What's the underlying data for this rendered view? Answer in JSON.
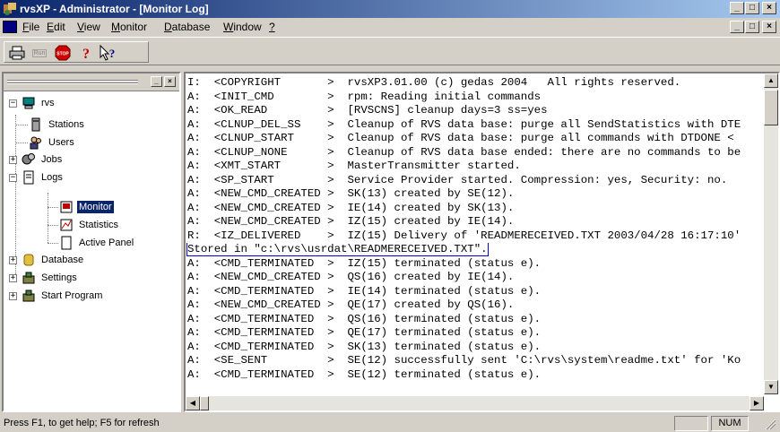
{
  "window": {
    "title": "rvsXP - Administrator - [Monitor Log]",
    "controls": {
      "minimize": "_",
      "maximize": "□",
      "close": "×"
    }
  },
  "menu": {
    "items": [
      {
        "label": "File",
        "key": "F",
        "rest": "ile"
      },
      {
        "label": "Edit",
        "key": "E",
        "rest": "dit"
      },
      {
        "label": "View",
        "key": "V",
        "rest": "iew"
      },
      {
        "label": "Monitor",
        "key": "M",
        "rest": "onitor"
      },
      {
        "label": "Database",
        "key": "D",
        "rest": "atabase"
      },
      {
        "label": "Window",
        "key": "W",
        "rest": "indow"
      },
      {
        "label": "?",
        "key": "?",
        "rest": ""
      }
    ]
  },
  "toolbar": {
    "buttons": [
      {
        "name": "print-button",
        "icon": "printer-icon"
      },
      {
        "name": "run-button",
        "icon": "run-icon",
        "text": "Run"
      },
      {
        "name": "stop-button",
        "icon": "stop-icon",
        "text": "STOP"
      },
      {
        "name": "help-button",
        "icon": "help-icon"
      },
      {
        "name": "context-help-button",
        "icon": "context-help-icon"
      }
    ]
  },
  "tree": {
    "root": "rvs",
    "items": [
      {
        "label": "Stations",
        "icon": "stations-icon"
      },
      {
        "label": "Users",
        "icon": "users-icon"
      },
      {
        "label": "Jobs",
        "icon": "jobs-icon"
      },
      {
        "label": "Logs",
        "icon": "logs-icon"
      },
      {
        "label": "Monitor",
        "icon": "monitor-log-icon",
        "selected": true
      },
      {
        "label": "Statistics",
        "icon": "statistics-icon"
      },
      {
        "label": "Active Panel",
        "icon": "active-panel-icon"
      },
      {
        "label": "Database",
        "icon": "database-icon"
      },
      {
        "label": "Settings",
        "icon": "settings-icon"
      },
      {
        "label": "Start Program",
        "icon": "start-program-icon"
      }
    ]
  },
  "log": {
    "lines": [
      "I:  <COPYRIGHT       >  rvsXP3.01.00 (c) gedas 2004   All rights reserved.",
      "A:  <INIT_CMD        >  rpm: Reading initial commands",
      "A:  <OK_READ         >  [RVSCNS] cleanup days=3 ss=yes",
      "A:  <CLNUP_DEL_SS    >  Cleanup of RVS data base: purge all SendStatistics with DTE",
      "A:  <CLNUP_START     >  Cleanup of RVS data base: purge all commands with DTDONE <",
      "A:  <CLNUP_NONE      >  Cleanup of RVS data base ended: there are no commands to be",
      "A:  <XMT_START       >  MasterTransmitter started.",
      "A:  <SP_START        >  Service Provider started. Compression: yes, Security: no.",
      "A:  <NEW_CMD_CREATED >  SK(13) created by SE(12).",
      "A:  <NEW_CMD_CREATED >  IE(14) created by SK(13).",
      "A:  <NEW_CMD_CREATED >  IZ(15) created by IE(14).",
      "R:  <IZ_DELIVERED    >  IZ(15) Delivery of 'READMERECEIVED.TXT 2003/04/28 16:17:10'",
      "Stored in \"c:\\rvs\\usrdat\\READMERECEIVED.TXT\".",
      "A:  <CMD_TERMINATED  >  IZ(15) terminated (status e).",
      "A:  <NEW_CMD_CREATED >  QS(16) created by IE(14).",
      "A:  <CMD_TERMINATED  >  IE(14) terminated (status e).",
      "A:  <NEW_CMD_CREATED >  QE(17) created by QS(16).",
      "A:  <CMD_TERMINATED  >  QS(16) terminated (status e).",
      "A:  <CMD_TERMINATED  >  QE(17) terminated (status e).",
      "A:  <CMD_TERMINATED  >  SK(13) terminated (status e).",
      "A:  <SE_SENT         >  SE(12) successfully sent 'C:\\rvs\\system\\readme.txt' for 'Ko",
      "A:  <CMD_TERMINATED  >  SE(12) terminated (status e)."
    ]
  },
  "status": {
    "help_text": "Press F1, to get help; F5 for refresh",
    "num_indicator": "NUM"
  }
}
